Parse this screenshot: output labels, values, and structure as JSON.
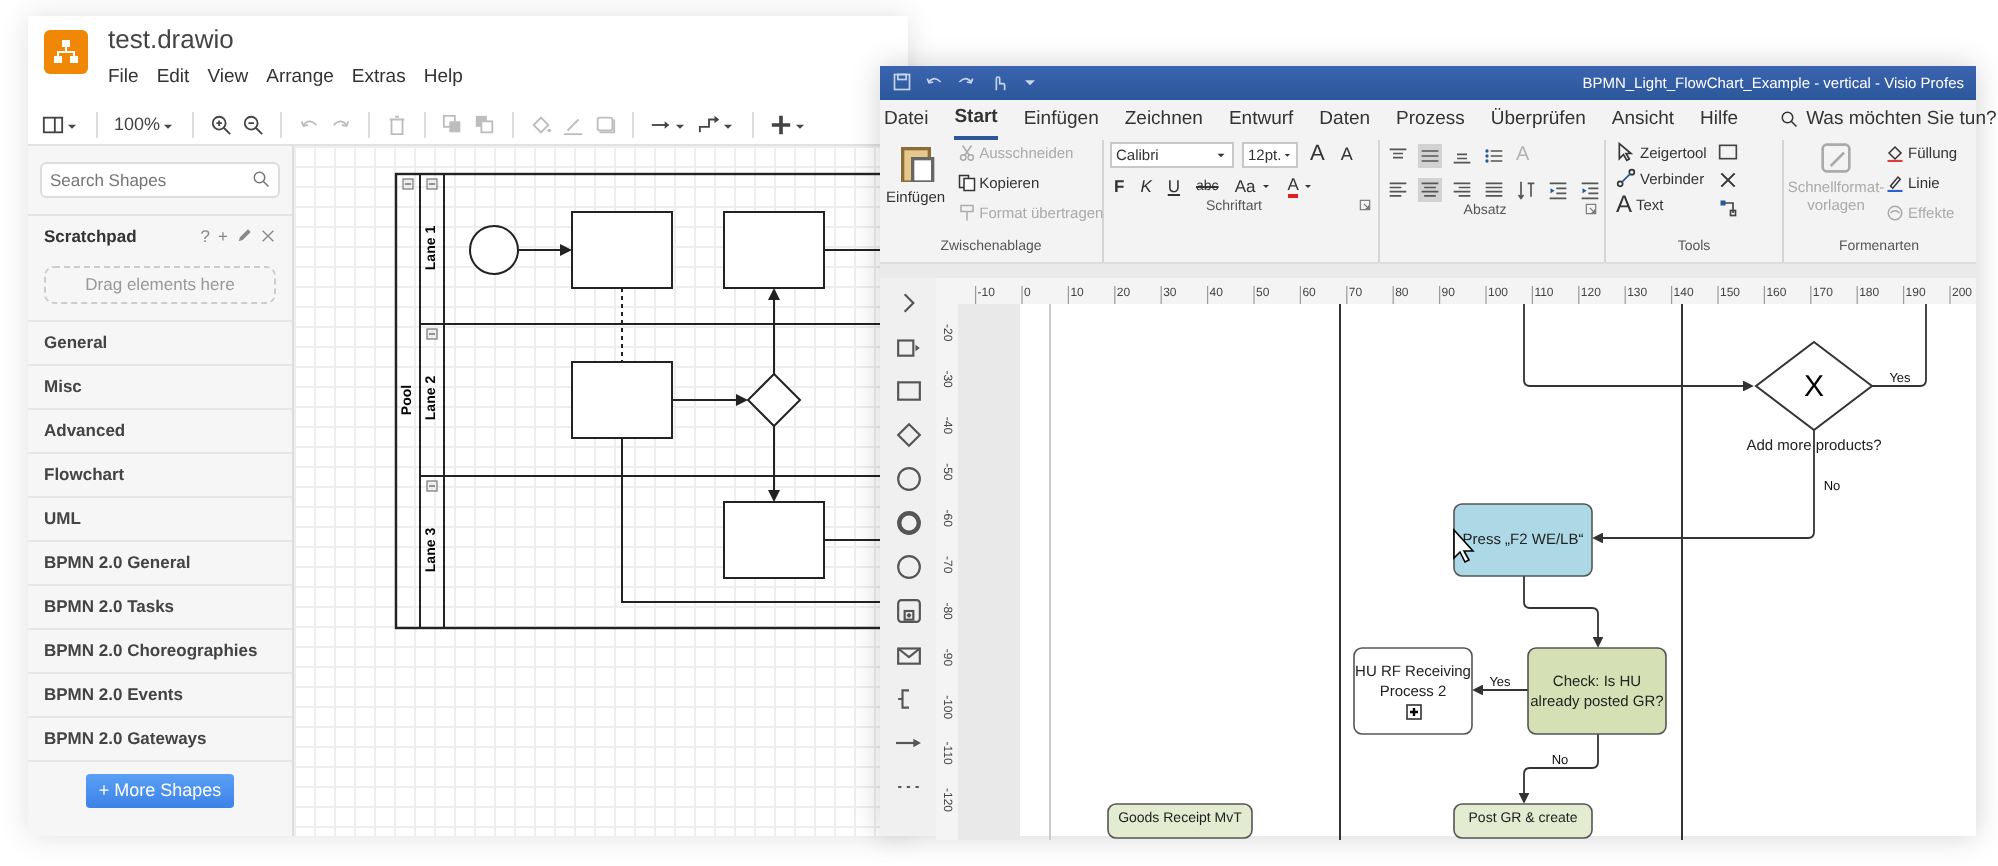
{
  "drawio": {
    "title": "test.drawio",
    "menu": [
      "File",
      "Edit",
      "View",
      "Arrange",
      "Extras",
      "Help"
    ],
    "toolbar": [
      [
        {
          "kind": "format-panel",
          "dropdown": true,
          "disabled": false
        }
      ],
      [
        {
          "kind": "zoom",
          "label": "100%",
          "dropdown": true,
          "disabled": false
        }
      ],
      [
        {
          "kind": "zoom-in",
          "dropdown": false,
          "disabled": false
        },
        {
          "kind": "zoom-out",
          "dropdown": false,
          "disabled": false
        }
      ],
      [
        {
          "kind": "undo",
          "dropdown": false,
          "disabled": true
        },
        {
          "kind": "redo",
          "dropdown": false,
          "disabled": true
        }
      ],
      [
        {
          "kind": "delete",
          "dropdown": false,
          "disabled": true
        }
      ],
      [
        {
          "kind": "to-front",
          "dropdown": false,
          "disabled": true
        },
        {
          "kind": "to-back",
          "dropdown": false,
          "disabled": true
        }
      ],
      [
        {
          "kind": "fill",
          "dropdown": false,
          "disabled": true
        },
        {
          "kind": "line",
          "dropdown": false,
          "disabled": true
        },
        {
          "kind": "shadow",
          "dropdown": false,
          "disabled": true
        }
      ],
      [
        {
          "kind": "connection",
          "dropdown": true,
          "disabled": false
        },
        {
          "kind": "waypoints",
          "dropdown": true,
          "disabled": false
        }
      ],
      [
        {
          "kind": "insert",
          "dropdown": true,
          "disabled": false
        }
      ]
    ],
    "search": {
      "placeholder": "Search Shapes"
    },
    "scratchpad": {
      "title": "Scratchpad",
      "help": "?",
      "add": "+"
    },
    "drop_hint": "Drag elements here",
    "libraries": [
      "General",
      "Misc",
      "Advanced",
      "Flowchart",
      "UML",
      "BPMN 2.0 General",
      "BPMN 2.0 Tasks",
      "BPMN 2.0 Choreographies",
      "BPMN 2.0 Events",
      "BPMN 2.0 Gateways"
    ],
    "more_button": "+ More Shapes",
    "pool": {
      "label": "Pool",
      "lanes": [
        "Lane 1",
        "Lane 2",
        "Lane 3"
      ]
    }
  },
  "visio": {
    "title": "BPMN_Light_FlowChart_Example - vertical  -  Visio Profes",
    "tabs": [
      {
        "label": "Datei",
        "selected": false
      },
      {
        "label": "Start",
        "selected": true
      },
      {
        "label": "Einfügen",
        "selected": false
      },
      {
        "label": "Zeichnen",
        "selected": false
      },
      {
        "label": "Entwurf",
        "selected": false
      },
      {
        "label": "Daten",
        "selected": false
      },
      {
        "label": "Prozess",
        "selected": false
      },
      {
        "label": "Überprüfen",
        "selected": false
      },
      {
        "label": "Ansicht",
        "selected": false
      },
      {
        "label": "Hilfe",
        "selected": false
      }
    ],
    "tell_me": "Was möchten Sie tun?",
    "clipboard": {
      "group": "Zwischenablage",
      "paste": "Einfügen",
      "items": [
        {
          "kind": "cut",
          "label": "Ausschneiden",
          "disabled": true
        },
        {
          "kind": "copy",
          "label": "Kopieren",
          "disabled": false
        },
        {
          "kind": "format-painter",
          "label": "Format übertragen",
          "disabled": true
        }
      ]
    },
    "font": {
      "group": "Schriftart",
      "name": "Calibri",
      "size": "12pt.",
      "size_buttons": [
        {
          "kind": "grow",
          "label": "A"
        },
        {
          "kind": "shrink",
          "label": "A"
        }
      ],
      "buttons": [
        {
          "kind": "bold",
          "label": "F"
        },
        {
          "kind": "italic",
          "label": "K"
        },
        {
          "kind": "underline",
          "label": "U"
        },
        {
          "kind": "strike",
          "label": "abc"
        },
        {
          "kind": "case",
          "label": "Aa"
        },
        {
          "kind": "color",
          "label": "A"
        }
      ]
    },
    "paragraph": {
      "group": "Absatz",
      "rows": [
        [
          {
            "kind": "align-top",
            "selected": false,
            "disabled": false
          },
          {
            "kind": "align-middle",
            "selected": true,
            "disabled": false
          },
          {
            "kind": "align-bottom",
            "selected": false,
            "disabled": false
          },
          {
            "kind": "bullets",
            "selected": false,
            "disabled": false
          },
          {
            "kind": "text-grow",
            "label": "A",
            "selected": false,
            "disabled": true
          }
        ],
        [
          {
            "kind": "align-left",
            "selected": false,
            "disabled": false
          },
          {
            "kind": "align-center",
            "selected": true,
            "disabled": false
          },
          {
            "kind": "align-right",
            "selected": false,
            "disabled": false
          },
          {
            "kind": "justify",
            "selected": false,
            "disabled": false
          },
          {
            "kind": "text-direction",
            "selected": false,
            "disabled": false
          },
          {
            "kind": "indent-less",
            "selected": false,
            "disabled": false
          },
          {
            "kind": "indent-more",
            "selected": false,
            "disabled": false
          }
        ]
      ]
    },
    "tools": {
      "group": "Tools",
      "items": [
        {
          "kind": "pointer",
          "label": "Zeigertool"
        },
        {
          "kind": "connector",
          "label": "Verbinder"
        },
        {
          "kind": "text",
          "glyph": "A",
          "label": "Text"
        }
      ]
    },
    "shape_styles": {
      "group": "Formenarten",
      "quick_styles": {
        "label": "Schnellformat-vorlagen",
        "disabled": true
      },
      "items": [
        {
          "kind": "fill",
          "label": "Füllung",
          "disabled": false
        },
        {
          "kind": "line",
          "label": "Linie",
          "disabled": false
        },
        {
          "kind": "effects",
          "label": "Effekte",
          "disabled": true
        }
      ]
    },
    "ruler": {
      "horizontal": [
        "-10",
        "0",
        "10",
        "20",
        "30",
        "40",
        "50",
        "60",
        "70",
        "80",
        "90",
        "100",
        "110",
        "120",
        "130",
        "140",
        "150",
        "160",
        "170",
        "180",
        "190",
        "200"
      ],
      "vertical": [
        "-20",
        "-30",
        "-40",
        "-50",
        "-60",
        "-70",
        "-80",
        "-90",
        "-100",
        "-110",
        "-120"
      ]
    },
    "diagram": {
      "gateway": {
        "symbol": "X",
        "label": "Add more products?",
        "yes": "Yes",
        "no": "No"
      },
      "press_task": "Press „F2 WE/LB“",
      "subprocess": "HU RF Receiving Process 2",
      "check_task": "Check: Is HU already posted GR?",
      "check_yes": "Yes",
      "check_no": "No",
      "goods_receipt_task": "Goods Receipt MvT",
      "post_task": "Post GR & create"
    }
  }
}
